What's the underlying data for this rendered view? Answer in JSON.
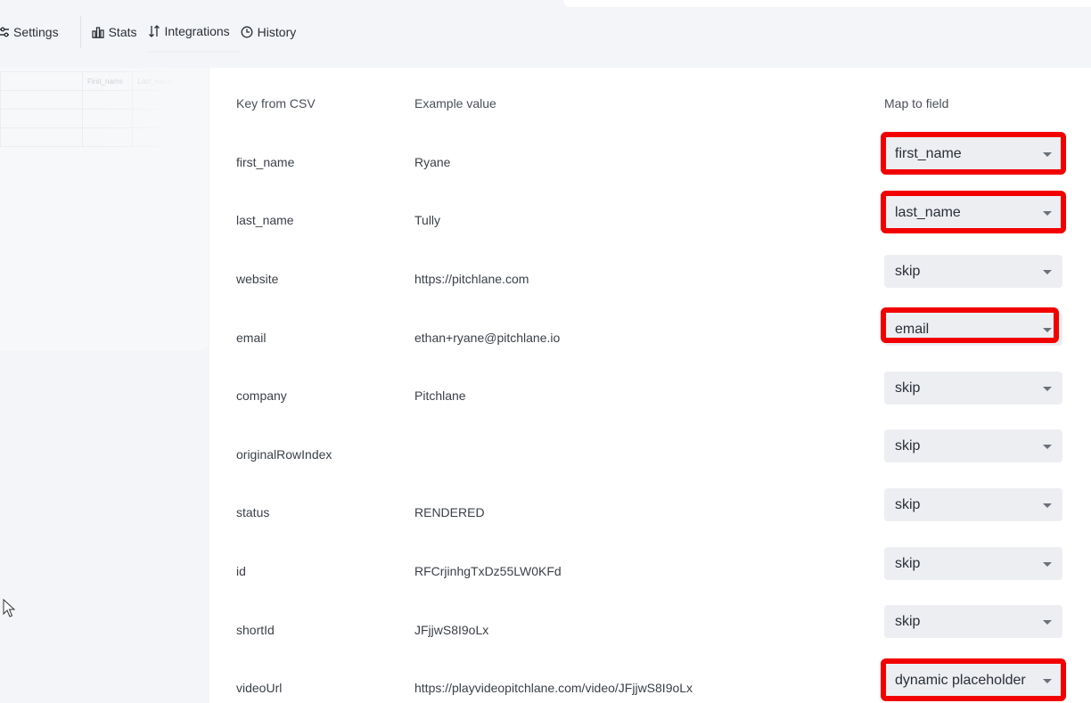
{
  "toolbar": {
    "settings": "Settings",
    "stats": "Stats",
    "integrations": "Integrations",
    "history": "History"
  },
  "preview_table": {
    "headers": [
      "",
      "First_name",
      "Last_name"
    ]
  },
  "mapping": {
    "headers": {
      "key": "Key from CSV",
      "example": "Example value",
      "map": "Map to field"
    },
    "rows": [
      {
        "key": "first_name",
        "example": "Ryane",
        "field": "first_name",
        "highlighted": true
      },
      {
        "key": "last_name",
        "example": "Tully",
        "field": "last_name",
        "highlighted": true
      },
      {
        "key": "website",
        "example": "https://pitchlane.com",
        "field": "skip",
        "highlighted": false
      },
      {
        "key": "email",
        "example": "ethan+ryane@pitchlane.io",
        "field": "email",
        "highlighted": true
      },
      {
        "key": "company",
        "example": "Pitchlane",
        "field": "skip",
        "highlighted": false
      },
      {
        "key": "originalRowIndex",
        "example": "",
        "field": "skip",
        "highlighted": false
      },
      {
        "key": "status",
        "example": "RENDERED",
        "field": "skip",
        "highlighted": false
      },
      {
        "key": "id",
        "example": "RFCrjinhgTxDz55LW0KFd",
        "field": "skip",
        "highlighted": false
      },
      {
        "key": "shortId",
        "example": "JFjjwS8I9oLx",
        "field": "skip",
        "highlighted": false
      },
      {
        "key": "videoUrl",
        "example": "https://playvideopitchlane.com/video/JFjjwS8I9oLx",
        "field": "dynamic placeholder",
        "highlighted": true
      }
    ]
  },
  "colors": {
    "highlight": "#f20000",
    "select_bg": "#eceef2"
  }
}
